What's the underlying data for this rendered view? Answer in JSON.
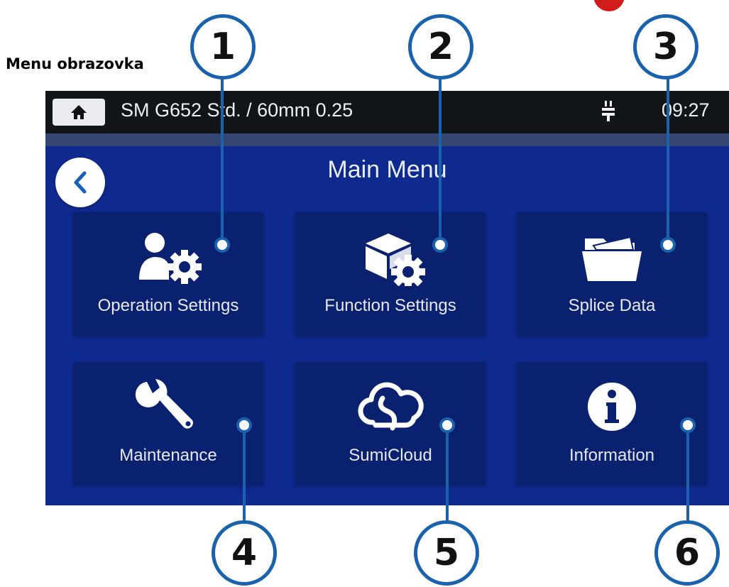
{
  "caption": "Menu obrazovka",
  "status_bar": {
    "mode": "SM G652 Std. / 60mm 0.25",
    "time": "09:27",
    "home_icon": "home-icon",
    "power_icon": "plug-icon"
  },
  "screen": {
    "title": "Main Menu",
    "back_icon": "chevron-left-icon"
  },
  "tiles": [
    {
      "label": "Operation Settings",
      "icon": "user-gear-icon"
    },
    {
      "label": "Function Settings",
      "icon": "box-gear-icon"
    },
    {
      "label": "Splice Data",
      "icon": "folder-icon"
    },
    {
      "label": "Maintenance",
      "icon": "wrench-icon"
    },
    {
      "label": "SumiCloud",
      "icon": "cloud-icon"
    },
    {
      "label": "Information",
      "icon": "info-icon"
    }
  ],
  "callouts": [
    "1",
    "2",
    "3",
    "4",
    "5",
    "6"
  ],
  "colors": {
    "screen_bg": "#0f2a8f",
    "tile_bg": "#0a2170",
    "callout": "#1a62ad",
    "marker": "#d01c1c"
  }
}
